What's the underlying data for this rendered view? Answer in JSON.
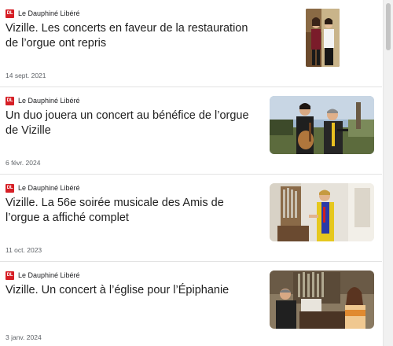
{
  "articles": [
    {
      "source": "Le Dauphiné Libéré",
      "logo_text": "DL",
      "headline": "Vizille. Les concerts en faveur de la restauration de l’orgue ont repris",
      "date": "14 sept. 2021",
      "thumbnail_icon": "two-musicians-photo"
    },
    {
      "source": "Le Dauphiné Libéré",
      "logo_text": "DL",
      "headline": "Un duo jouera un concert au bénéfice de l’orgue de Vizille",
      "date": "6 févr. 2024",
      "thumbnail_icon": "duo-musicians-outdoor-photo"
    },
    {
      "source": "Le Dauphiné Libéré",
      "logo_text": "DL",
      "headline": "Vizille. La 56e soirée musicale des Amis de l’orgue a affiché complet",
      "date": "11 oct. 2023",
      "thumbnail_icon": "organist-at-organ-photo"
    },
    {
      "source": "Le Dauphiné Libéré",
      "logo_text": "DL",
      "headline": "Vizille. Un concert à l’église pour l’Épiphanie",
      "date": "3 janv. 2024",
      "thumbnail_icon": "musicians-in-church-photo"
    }
  ],
  "colors": {
    "source_logo": "#d61f26",
    "date_text": "#5f6368",
    "divider": "#e3e3e3"
  }
}
